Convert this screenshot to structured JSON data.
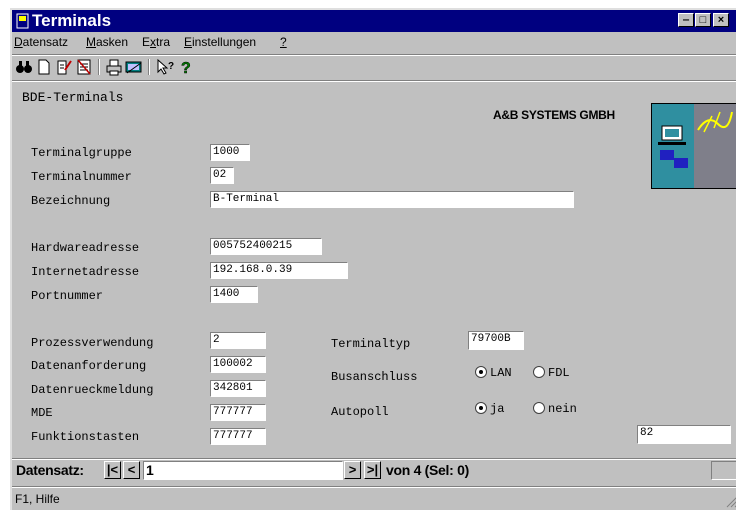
{
  "window": {
    "title": "Terminals"
  },
  "menu": {
    "items": [
      {
        "label": "Datensatz",
        "underline": "D"
      },
      {
        "label": "Masken",
        "underline": "M"
      },
      {
        "label": "Extra",
        "underline": "x"
      },
      {
        "label": "Einstellungen",
        "underline": "E"
      },
      {
        "label": "?",
        "underline": "?"
      }
    ]
  },
  "toolbar": {
    "icons": [
      "binoculars-icon",
      "new-document-icon",
      "edit-document-icon",
      "delete-document-icon",
      "print-icon",
      "screen-icon",
      "context-help-icon",
      "help-icon"
    ]
  },
  "form": {
    "heading": "BDE-Terminals",
    "company": "A&B SYSTEMS GMBH",
    "terminalgruppe_label": "Terminalgruppe",
    "terminalgruppe_value": "1000",
    "terminalnummer_label": "Terminalnummer",
    "terminalnummer_value": "02",
    "bezeichnung_label": "Bezeichnung",
    "bezeichnung_value": "B-Terminal",
    "hardwareadresse_label": "Hardwareadresse",
    "hardwareadresse_value": "005752400215",
    "internetadresse_label": "Internetadresse",
    "internetadresse_value": "192.168.0.39",
    "portnummer_label": "Portnummer",
    "portnummer_value": "1400",
    "prozessverwendung_label": "Prozessverwendung",
    "prozessverwendung_value": "2",
    "datenanforderung_label": "Datenanforderung",
    "datenanforderung_value": "100002",
    "datenrueckmeldung_label": "Datenrueckmeldung",
    "datenrueckmeldung_value": "342801",
    "mde_label": "MDE",
    "mde_value": "777777",
    "funktionstasten_label": "Funktionstasten",
    "funktionstasten_value": "777777",
    "terminaltyp_label": "Terminaltyp",
    "terminaltyp_value": "79700B",
    "busanschluss_label": "Busanschluss",
    "bus_options": [
      {
        "label": "LAN",
        "checked": true
      },
      {
        "label": "FDL",
        "checked": false
      }
    ],
    "autopoll_label": "Autopoll",
    "autopoll_options": [
      {
        "label": "ja",
        "checked": true
      },
      {
        "label": "nein",
        "checked": false
      }
    ],
    "extra_value": "82"
  },
  "navigator": {
    "label": "Datensatz:",
    "record_value": "1",
    "count_text": "von 4 (Sel: 0)",
    "first_glyph": "|<",
    "prev_glyph": "<",
    "next_glyph": ">",
    "last_glyph": ">|"
  },
  "status": {
    "text": "F1, Hilfe"
  }
}
